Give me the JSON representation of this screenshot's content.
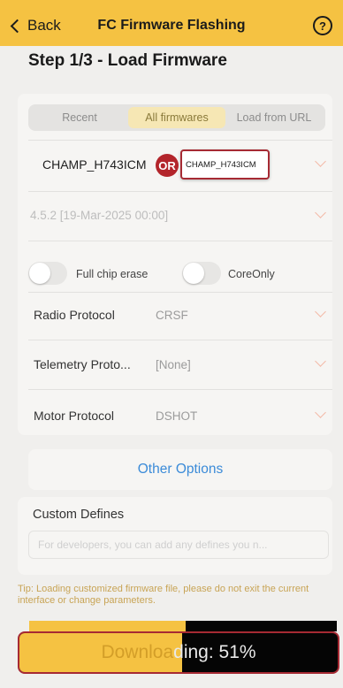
{
  "header": {
    "back_label": "Back",
    "title": "FC Firmware Flashing",
    "help_glyph": "?",
    "color": "#f5c242"
  },
  "step_title": "Step 1/3 - Load Firmware",
  "source_tabs": [
    {
      "label": "Recent",
      "active": false
    },
    {
      "label": "All firmwares",
      "active": true
    },
    {
      "label": "Load from URL",
      "active": false
    }
  ],
  "firmware_target": {
    "value": "CHAMP_H743ICM",
    "or_badge": "OR",
    "suggested_value": "CHAMP_H743ICM"
  },
  "firmware_version": {
    "value": "4.5.2 [19-Mar-2025 00:00]"
  },
  "options": {
    "full_chip_erase": {
      "label": "Full chip erase",
      "enabled": false
    },
    "core_only": {
      "label": "CoreOnly",
      "enabled": false
    }
  },
  "protocols": [
    {
      "label": "Radio Protocol",
      "value": "CRSF"
    },
    {
      "label": "Telemetry Proto...",
      "value": "[None]"
    },
    {
      "label": "Motor Protocol",
      "value": "DSHOT"
    }
  ],
  "other_options_label": "Other Options",
  "custom_defines": {
    "title": "Custom Defines",
    "placeholder": "For developers, you can add any defines you n..."
  },
  "tip": "Tip: Loading customized firmware file, please do not exit the current interface or change parameters.",
  "download": {
    "text_part1": "Downloa",
    "text_part2": "ding: 51%",
    "progress": 0.51,
    "fill_color": "#f5c242",
    "bg_color": "#050505"
  },
  "icons": {
    "back": "chevron-left-icon",
    "help": "question-circle-icon",
    "dropdown": "chevron-down-icon"
  }
}
